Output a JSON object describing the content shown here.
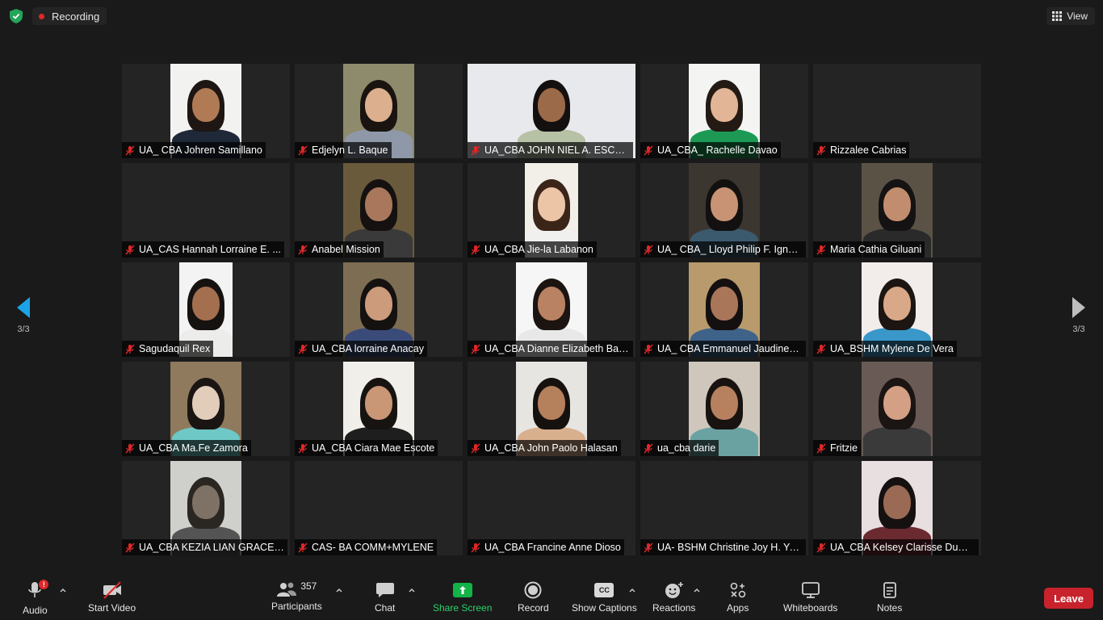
{
  "topbar": {
    "recording_label": "Recording",
    "view_label": "View"
  },
  "navigation": {
    "prev_page": "3/3",
    "next_page": "3/3"
  },
  "participants_grid": [
    {
      "name": "UA_ CBA Johren Samillano",
      "video": true
    },
    {
      "name": "Edjelyn L. Baque",
      "video": true
    },
    {
      "name": "UA_CBA JOHN NIEL A. ESCOT...",
      "video": true
    },
    {
      "name": "UA_CBA_ Rachelle Davao",
      "video": true
    },
    {
      "name": "Rizzalee Cabrias",
      "video": false
    },
    {
      "name": "UA_CAS Hannah Lorraine E. ...",
      "video": false
    },
    {
      "name": "Anabel Mission",
      "video": true
    },
    {
      "name": "UA_CBA Jie-la Labanon",
      "video": true
    },
    {
      "name": "UA_ CBA_ Lloyd Philip F. Ignacio",
      "video": true
    },
    {
      "name": "Maria Cathia Giluani",
      "video": true
    },
    {
      "name": "Sagudaquil Rex",
      "video": true
    },
    {
      "name": "UA_CBA lorraine Anacay",
      "video": true
    },
    {
      "name": "UA_CBA Dianne Elizabeth Bart...",
      "video": true
    },
    {
      "name": "UA_ CBA Emmanuel Jaudines ...",
      "video": true
    },
    {
      "name": "UA_BSHM Mylene De Vera",
      "video": true
    },
    {
      "name": "UA_CBA Ma.Fe Zamora",
      "video": true
    },
    {
      "name": "UA_CBA Ciara Mae Escote",
      "video": true
    },
    {
      "name": "UA_CBA John Paolo Halasan",
      "video": true
    },
    {
      "name": "ua_cba darie",
      "video": true
    },
    {
      "name": "Fritzie",
      "video": true
    },
    {
      "name": "UA_CBA KEZIA LIAN GRACE E....",
      "video": true
    },
    {
      "name": "CAS- BA COMM+MYLENE",
      "video": false
    },
    {
      "name": "UA_CBA Francine Anne Dioso",
      "video": false
    },
    {
      "name": "UA- BSHM Christine Joy H. Ya...",
      "video": false
    },
    {
      "name": "UA_CBA Kelsey Clarisse Dumd...",
      "video": true
    }
  ],
  "toolbar": {
    "audio_label": "Audio",
    "audio_badge": "!",
    "video_label": "Start Video",
    "participants_label": "Participants",
    "participants_count": "357",
    "chat_label": "Chat",
    "share_label": "Share Screen",
    "record_label": "Record",
    "captions_label": "Show Captions",
    "captions_icon_text": "CC",
    "reactions_label": "Reactions",
    "apps_label": "Apps",
    "whiteboards_label": "Whiteboards",
    "notes_label": "Notes",
    "leave_label": "Leave"
  },
  "colors": {
    "background": "#1a1a1a",
    "tile": "#242424",
    "share_green": "#12b347",
    "leave_red": "#c8232c",
    "nav_blue": "#1aa3e8",
    "muted_red": "#e02828"
  }
}
